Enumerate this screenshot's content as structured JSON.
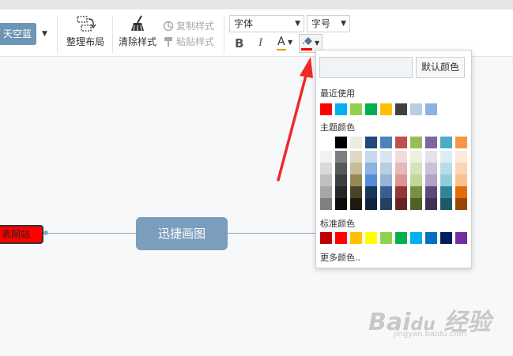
{
  "toolbar": {
    "theme_label": "天空蓝",
    "arrange_label": "整理布局",
    "clear_style_label": "清除样式",
    "copy_style_label": "复制样式",
    "paste_style_label": "粘贴样式",
    "font_select": "字体",
    "size_select": "字号",
    "bold_label": "B",
    "italic_label": "I",
    "font_color_label": "A",
    "font_color_bar": "#d9a400",
    "fill_color_bar": "#ff0000",
    "icons": [
      "arrange-layout-icon",
      "broom-icon",
      "copy-style-icon",
      "paint-roller-icon",
      "paint-bucket-icon"
    ]
  },
  "canvas": {
    "left_node": "表网站",
    "center_node": "迅捷画图",
    "left_node_color": "#ff0000",
    "center_node_color": "#7b9ebd"
  },
  "color_panel": {
    "hex_value": "",
    "default_button": "默认颜色",
    "recent_label": "最近使用",
    "recent_colors": [
      "#ff0000",
      "#00b0f0",
      "#92d050",
      "#00b050",
      "#ffc000",
      "#404040",
      "#b8cce4",
      "#8db3e2"
    ],
    "theme_label": "主题颜色",
    "theme_columns": [
      [
        "#ffffff",
        "#f2f2f2",
        "#d9d9d9",
        "#bfbfbf",
        "#a6a6a6",
        "#808080"
      ],
      [
        "#000000",
        "#7f7f7f",
        "#595959",
        "#3f3f3f",
        "#262626",
        "#0c0c0c"
      ],
      [
        "#eeece1",
        "#ddd9c3",
        "#c4bd97",
        "#938953",
        "#494429",
        "#1d1b10"
      ],
      [
        "#1f497d",
        "#c6d9f0",
        "#8db3e2",
        "#548dd4",
        "#17365d",
        "#0f243e"
      ],
      [
        "#4f81bd",
        "#dbe5f1",
        "#b8cce4",
        "#95b3d7",
        "#366092",
        "#244061"
      ],
      [
        "#c0504d",
        "#f2dcdb",
        "#e5b9b7",
        "#d99694",
        "#953734",
        "#632423"
      ],
      [
        "#9bbb59",
        "#ebf1dd",
        "#d7e3bc",
        "#c3d69b",
        "#76923c",
        "#4f6128"
      ],
      [
        "#8064a2",
        "#e5e0ec",
        "#ccc1d9",
        "#b2a2c7",
        "#5f497a",
        "#3f3151"
      ],
      [
        "#4bacc6",
        "#dbeef3",
        "#b7dde8",
        "#92cddc",
        "#31859b",
        "#205867"
      ],
      [
        "#f79646",
        "#fdeada",
        "#fbd5b5",
        "#fac08f",
        "#e36c09",
        "#974806"
      ]
    ],
    "standard_label": "标准颜色",
    "standard_colors": [
      "#c00000",
      "#ff0000",
      "#ffc000",
      "#ffff00",
      "#92d050",
      "#00b050",
      "#00b0f0",
      "#0070c0",
      "#002060",
      "#7030a0"
    ],
    "more_colors": "更多颜色.."
  },
  "annotation": {
    "arrow_color": "#ee2a2a"
  },
  "watermark": {
    "brand": "Bai du 经验",
    "url": "jingyan.baidu.com"
  }
}
